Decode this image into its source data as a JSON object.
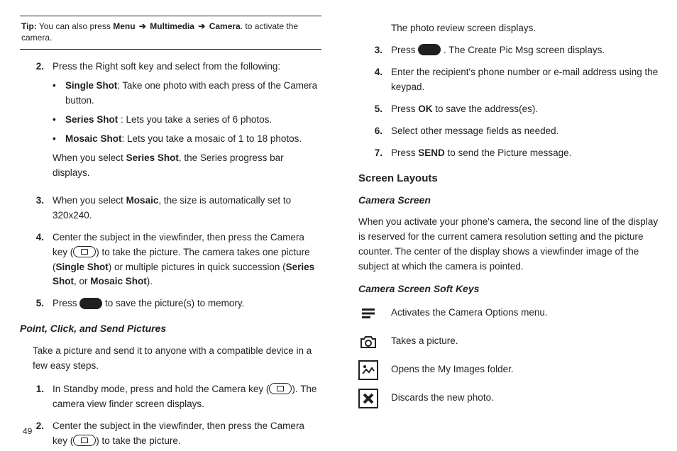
{
  "tip": {
    "prefix": "Tip:",
    "body_a": " You can also press ",
    "menu": "Menu",
    "arrow": " ➔ ",
    "multimedia": "Multimedia",
    "camera": "Camera",
    "body_b": ". to activate the camera."
  },
  "left": {
    "step2": {
      "num": "2.",
      "lead": "Press the Right soft key and select from the following:",
      "b1_label": "Single Shot",
      "b1_text": ": Take one photo with each press of the Camera button.",
      "b2_label": "Series Shot",
      "b2_text": " : Lets you take a series of 6 photos.",
      "b3_label": "Mosaic Shot",
      "b3_text": ": Lets you take a mosaic of 1 to 18 photos.",
      "s2a": "When you select ",
      "s2b": "Series Shot",
      "s2c": ", the Series progress bar displays."
    },
    "step3": {
      "num": "3.",
      "a": "When you select ",
      "b": "Mosaic",
      "c": ", the size is automatically set to 320x240."
    },
    "step4": {
      "num": "4.",
      "a": "Center the subject in the viewfinder, then press the Camera key (",
      "b": ") to take the picture. The camera takes one picture (",
      "c": "Single Shot",
      "d": ") or multiple pictures in quick succession (",
      "e": "Series Shot",
      "f": ", or ",
      "g": "Mosaic Shot",
      "h": ")."
    },
    "step5": {
      "num": "5.",
      "a": "Press ",
      "b": " to save the picture(s) to memory."
    },
    "heading_pcs": "Point, Click, and Send Pictures",
    "pcs_intro": "Take a picture and send it to anyone with a compatible device in a few easy steps.",
    "pcs1": {
      "num": "1.",
      "a": "In Standby mode, press and hold the Camera key (",
      "b": "). The camera view finder screen displays."
    },
    "pcs2": {
      "num": "2.",
      "a": "Center the subject in the viewfinder, then press the Camera key (",
      "b": ") to take the picture."
    }
  },
  "right": {
    "r2b": "The photo review screen displays.",
    "r3": {
      "num": "3.",
      "a": "Press ",
      "b": ". The Create Pic Msg screen displays."
    },
    "r4": {
      "num": "4.",
      "a": "Enter the recipient's phone number or e-mail address using the keypad."
    },
    "r5": {
      "num": "5.",
      "a": "Press ",
      "b": "OK",
      "c": " to save the address(es)."
    },
    "r6": {
      "num": "6.",
      "a": "Select other message fields as needed."
    },
    "r7": {
      "num": "7.",
      "a": "Press ",
      "b": "SEND",
      "c": " to send the Picture message."
    },
    "screen_layouts": "Screen Layouts",
    "camera_screen": "Camera Screen",
    "cs_para": "When you activate your phone's camera, the second line of the display is reserved for the current camera resolution setting and the picture counter. The center of the display shows a viewfinder image of the subject at which the camera is pointed.",
    "soft_keys": "Camera Screen Soft Keys",
    "sk1": "Activates the Camera Options menu.",
    "sk2": "Takes a picture.",
    "sk3": "Opens the My Images folder.",
    "sk4": "Discards the new photo."
  },
  "page_number": "49"
}
